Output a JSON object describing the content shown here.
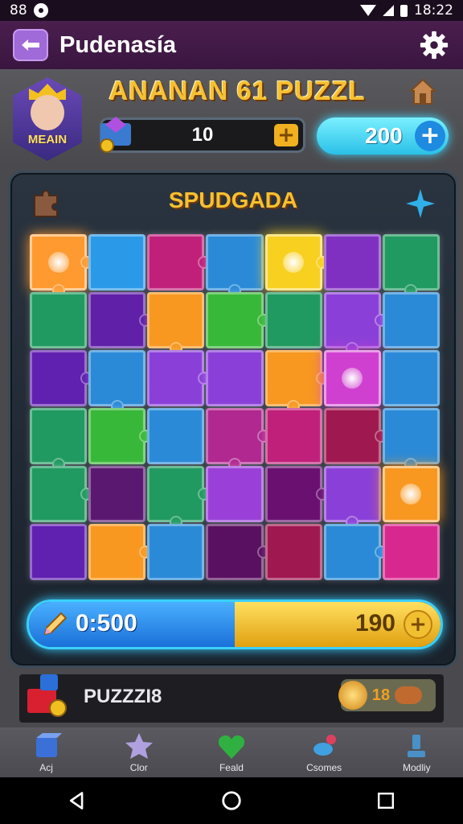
{
  "status_bar": {
    "left_text": "88",
    "time": "18:22"
  },
  "app_bar": {
    "title": "Pudenasía"
  },
  "header": {
    "avatar_label": "MEAIN",
    "game_title": "ANANAN 61 PUZZL",
    "gem_count": "10",
    "coin_count": "200"
  },
  "board": {
    "title": "SPUDGADA",
    "tiles": [
      [
        "#ff9a30",
        "#2a9ae8",
        "#c0207a",
        "#2a8ad8",
        "#f8d020",
        "#8030c0",
        "#209a60"
      ],
      [
        "#209a60",
        "#6020a8",
        "#f89820",
        "#38b838",
        "#209a60",
        "#8a40d8",
        "#2a8ad8"
      ],
      [
        "#6020b0",
        "#2a8ad8",
        "#8a40d8",
        "#8a40d8",
        "#f89820",
        "#d040d0",
        "#2a8ad8"
      ],
      [
        "#209a60",
        "#38b838",
        "#2a8ad8",
        "#b02890",
        "#c0207a",
        "#a01850",
        "#2a8ad8"
      ],
      [
        "#209a60",
        "#5a1870",
        "#209a60",
        "#9a40d8",
        "#6a1070",
        "#8a40d8",
        "#f89820"
      ],
      [
        "#6020b0",
        "#f89820",
        "#2a8ad8",
        "#5a1060",
        "#a01850",
        "#2a8ad8",
        "#d82890"
      ]
    ],
    "glow_tiles": [
      [
        0,
        0
      ],
      [
        0,
        4
      ],
      [
        2,
        5
      ],
      [
        4,
        6
      ]
    ]
  },
  "progress": {
    "timer": "0:500",
    "score": "190",
    "fill_fraction": 0.5
  },
  "puzzle_strip": {
    "label": "PUZZZI8",
    "value": "18"
  },
  "bottom_nav": [
    {
      "label": "Acj",
      "icon": "cube-icon",
      "color": "#3a70d8"
    },
    {
      "label": "Clor",
      "icon": "star-icon",
      "color": "#b0a0e0"
    },
    {
      "label": "Feald",
      "icon": "heart-icon",
      "color": "#30b040"
    },
    {
      "label": "Csomes",
      "icon": "bird-icon",
      "color": "#40a0e0"
    },
    {
      "label": "Modliy",
      "icon": "trophy-icon",
      "color": "#4a90c8"
    }
  ]
}
